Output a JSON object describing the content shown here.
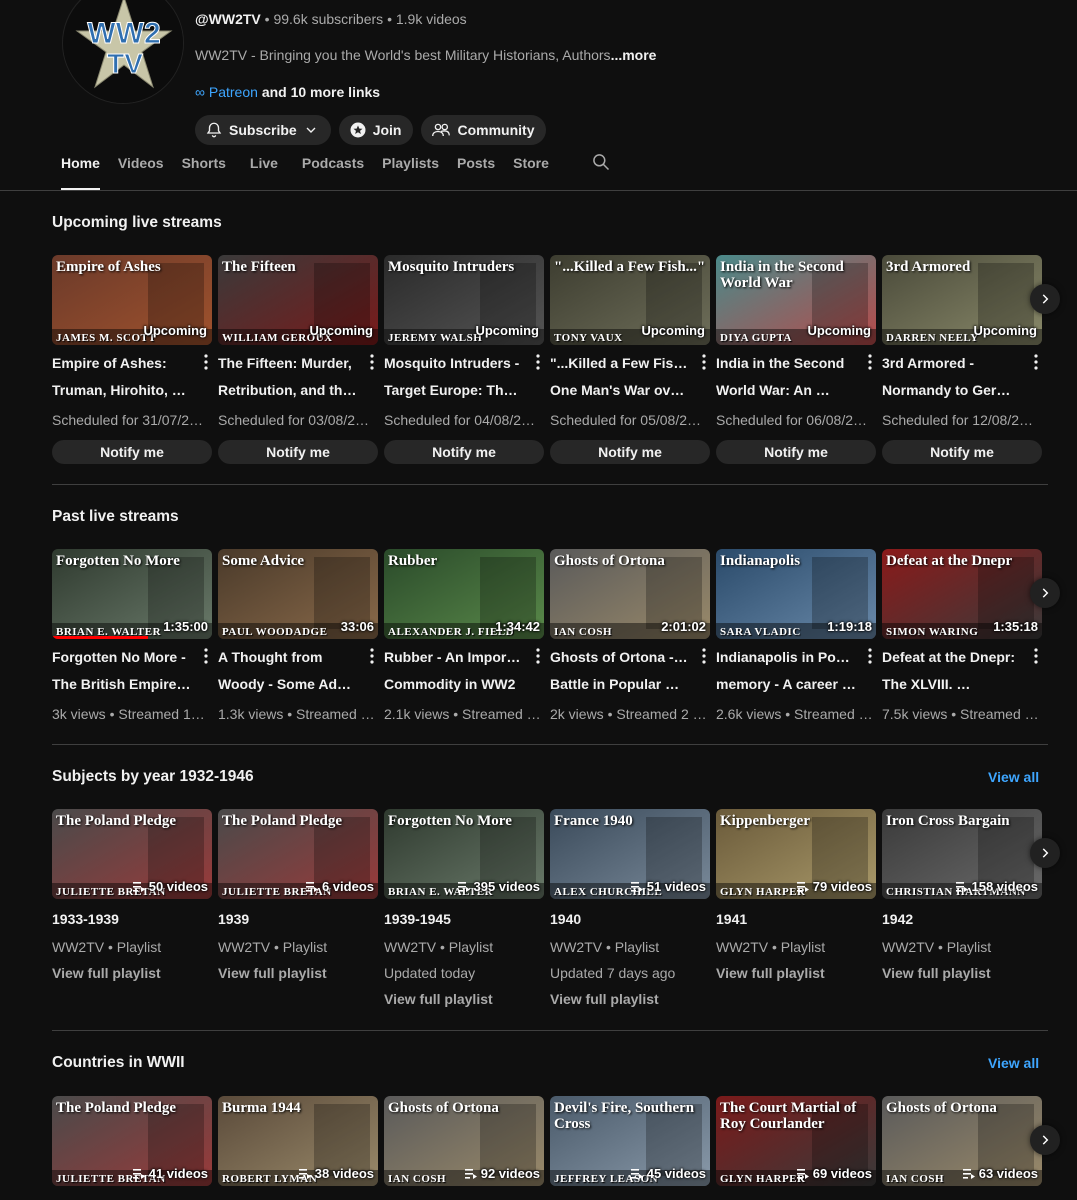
{
  "channel": {
    "handle": "@WW2TV",
    "subscribers": "99.6k subscribers",
    "videos": "1.9k videos",
    "description": "WW2TV - Bringing you the World's best Military Historians, Authors",
    "more_label": "...more",
    "link_label": "Patreon",
    "more_links": "and 10 more links",
    "logo_text_1": "WW2",
    "logo_text_2": "TV"
  },
  "buttons": {
    "subscribe": "Subscribe",
    "join": "Join",
    "community": "Community"
  },
  "tabs": [
    "Home",
    "Videos",
    "Shorts",
    "Live",
    "Podcasts",
    "Playlists",
    "Posts",
    "Store"
  ],
  "upcoming": {
    "title": "Upcoming live streams",
    "badge": "Upcoming",
    "notify_label": "Notify me",
    "items": [
      {
        "thumb_title": "Empire of Ashes",
        "thumb_author": "JAMES M. SCOTT",
        "line1": "Empire of Ashes:",
        "line2": "Truman, Hirohito, and…",
        "meta": "Scheduled for 31/07/20…",
        "colors": [
          "#6b3a2a",
          "#a0522d"
        ]
      },
      {
        "thumb_title": "The Fifteen",
        "thumb_author": "WILLIAM GEROUX",
        "line1": "The Fifteen: Murder,",
        "line2": "Retribution, and the …",
        "meta": "Scheduled for 03/08/20…",
        "colors": [
          "#3a3a3a",
          "#7a1a1a"
        ]
      },
      {
        "thumb_title": "Mosquito Intruders",
        "thumb_author": "JEREMY WALSH",
        "line1": "Mosquito Intruders -",
        "line2": "Target Europe: The …",
        "meta": "Scheduled for 04/08/20…",
        "colors": [
          "#2a2a2a",
          "#555555"
        ]
      },
      {
        "thumb_title": "\"...Killed a Few Fish...\"",
        "thumb_author": "TONY VAUX",
        "line1": "\"...Killed a Few Fish...\"",
        "line2": "One Man's War over …",
        "meta": "Scheduled for 05/08/20…",
        "colors": [
          "#3d3d30",
          "#6f6f5a"
        ]
      },
      {
        "thumb_title": "India in the Second World War",
        "thumb_author": "DIYA GUPTA",
        "line1": "India in the Second",
        "line2": "World War: An …",
        "meta": "Scheduled for 06/08/20…",
        "colors": [
          "#4a8a8a",
          "#b84a4a"
        ]
      },
      {
        "thumb_title": "3rd Armored",
        "thumb_author": "DARREN NEELY",
        "line1": "3rd Armored -",
        "line2": "Normandy to German…",
        "meta": "Scheduled for 12/08/20…",
        "colors": [
          "#4a4a3a",
          "#8a8a6a"
        ]
      }
    ]
  },
  "past": {
    "title": "Past live streams",
    "items": [
      {
        "thumb_title": "Forgotten No More",
        "thumb_author": "BRIAN E. WALTER",
        "duration": "1:35:00",
        "line1": "Forgotten No More -",
        "line2": "The British Empire's …",
        "meta": "3k views • Streamed 17 …",
        "colors": [
          "#2f3a2f",
          "#6a7a6a"
        ],
        "progress": 0.6
      },
      {
        "thumb_title": "Some Advice",
        "thumb_author": "PAUL WOODADGE",
        "duration": "33:06",
        "line1": "A Thought from",
        "line2": "Woody - Some Advic…",
        "meta": "1.3k views • Streamed 2…",
        "colors": [
          "#4a3a2a",
          "#8a6a4a"
        ],
        "progress": 0
      },
      {
        "thumb_title": "Rubber",
        "thumb_author": "ALEXANDER J. FIELD",
        "duration": "1:34:42",
        "line1": "Rubber - An Important",
        "line2": "Commodity in WW2",
        "meta": "2.1k views • Streamed 1 …",
        "colors": [
          "#2a4a2a",
          "#5a8a4a"
        ],
        "progress": 0
      },
      {
        "thumb_title": "Ghosts of Ortona",
        "thumb_author": "IAN COSH",
        "duration": "2:01:02",
        "line1": "Ghosts of Ortona - The",
        "line2": "Battle in Popular …",
        "meta": "2k views • Streamed 2 d…",
        "colors": [
          "#5a5a5a",
          "#9a8a6a"
        ],
        "progress": 0
      },
      {
        "thumb_title": "Indianapolis",
        "thumb_author": "SARA VLADIC",
        "duration": "1:19:18",
        "line1": "Indianapolis in Popular",
        "line2": "memory - A career of …",
        "meta": "2.6k views • Streamed 5 …",
        "colors": [
          "#2a4a6a",
          "#6a8aaa"
        ],
        "progress": 0
      },
      {
        "thumb_title": "Defeat at the Dnepr",
        "thumb_author": "SIMON WARING",
        "duration": "1:35:18",
        "line1": "Defeat at the Dnepr:",
        "line2": "The XLVIII. …",
        "meta": "7.5k views • Streamed 7 …",
        "colors": [
          "#8a1a1a",
          "#3a3a3a"
        ],
        "progress": 0
      }
    ]
  },
  "subjects": {
    "title": "Subjects by year 1932-1946",
    "view_all": "View all",
    "items": [
      {
        "thumb_title": "The Poland Pledge",
        "thumb_author": "JULIETTE BRETAN",
        "count": "50 videos",
        "name": "1933-1939",
        "meta1": "WW2TV • Playlist",
        "meta2": "",
        "link": "View full playlist",
        "colors": [
          "#4a4a4a",
          "#9a3a3a"
        ]
      },
      {
        "thumb_title": "The Poland Pledge",
        "thumb_author": "JULIETTE BRETAN",
        "count": "6 videos",
        "name": "1939",
        "meta1": "WW2TV • Playlist",
        "meta2": "",
        "link": "View full playlist",
        "colors": [
          "#4a4a4a",
          "#9a3a3a"
        ]
      },
      {
        "thumb_title": "Forgotten No More",
        "thumb_author": "BRIAN E. WALTER",
        "count": "395 videos",
        "name": "1939-1945",
        "meta1": "WW2TV • Playlist",
        "meta2": "Updated today",
        "link": "View full playlist",
        "colors": [
          "#2f3a2f",
          "#6a7a6a"
        ]
      },
      {
        "thumb_title": "France 1940",
        "thumb_author": "ALEX CHURCHILL",
        "count": "51 videos",
        "name": "1940",
        "meta1": "WW2TV • Playlist",
        "meta2": "Updated 7 days ago",
        "link": "View full playlist",
        "colors": [
          "#3a4a5a",
          "#7a8a9a"
        ]
      },
      {
        "thumb_title": "Kippenberger",
        "thumb_author": "GLYN HARPER",
        "count": "79 videos",
        "name": "1941",
        "meta1": "WW2TV • Playlist",
        "meta2": "",
        "link": "View full playlist",
        "colors": [
          "#6a5a3a",
          "#aa9a6a"
        ]
      },
      {
        "thumb_title": "Iron Cross Bargain",
        "thumb_author": "CHRISTIAN HARTMANN",
        "count": "158 videos",
        "name": "1942",
        "meta1": "WW2TV • Playlist",
        "meta2": "",
        "link": "View full playlist",
        "colors": [
          "#3a3a3a",
          "#6a6a6a"
        ]
      }
    ]
  },
  "countries": {
    "title": "Countries in WWII",
    "view_all": "View all",
    "items": [
      {
        "thumb_title": "The Poland Pledge",
        "thumb_author": "JULIETTE BRETAN",
        "count": "41 videos",
        "colors": [
          "#4a4a4a",
          "#9a3a3a"
        ]
      },
      {
        "thumb_title": "Burma 1944",
        "thumb_author": "ROBERT LYMAN",
        "count": "38 videos",
        "colors": [
          "#5a4a3a",
          "#9a8a6a"
        ]
      },
      {
        "thumb_title": "Ghosts of Ortona",
        "thumb_author": "IAN COSH",
        "count": "92 videos",
        "colors": [
          "#5a5a5a",
          "#9a8a6a"
        ]
      },
      {
        "thumb_title": "Devil's Fire, Southern Cross",
        "thumb_author": "JEFFREY LEASON",
        "count": "45 videos",
        "colors": [
          "#4a5a6a",
          "#8a9aaa"
        ]
      },
      {
        "thumb_title": "The Court Martial of Roy Courlander",
        "thumb_author": "GLYN HARPER",
        "count": "69 videos",
        "colors": [
          "#7a1a1a",
          "#3a3a3a"
        ]
      },
      {
        "thumb_title": "Ghosts of Ortona",
        "thumb_author": "IAN COSH",
        "count": "63 videos",
        "colors": [
          "#5a5a5a",
          "#9a8a6a"
        ]
      }
    ]
  },
  "colors": {
    "accent_link": "#3ea6ff",
    "bg": "#0f0f0f",
    "pill": "#272727"
  }
}
